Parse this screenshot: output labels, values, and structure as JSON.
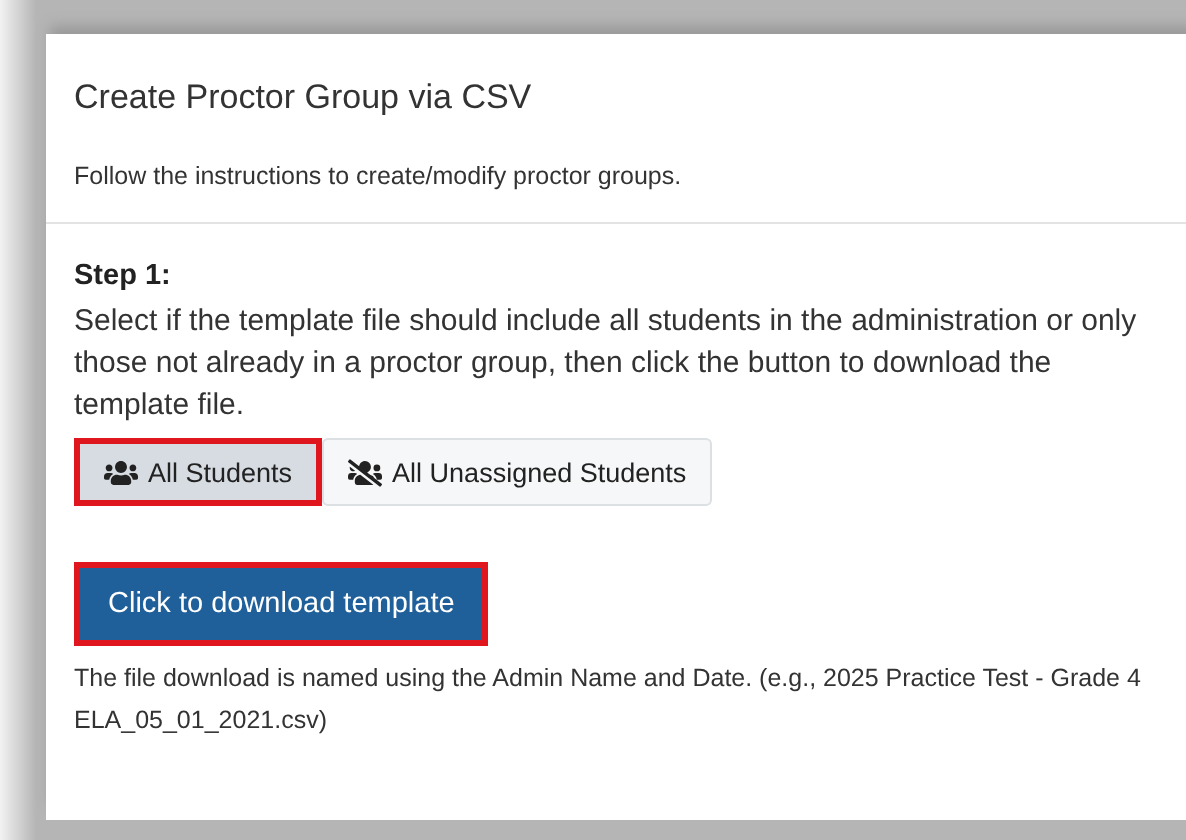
{
  "dialog": {
    "title": "Create Proctor Group via CSV",
    "subtitle": "Follow the instructions to create/modify proctor groups."
  },
  "step": {
    "heading": "Step 1:",
    "instructions": "Select if the template file should include all students in the administration or only those not already in a proctor group, then click the button to download the template file."
  },
  "options": [
    {
      "label": "All Students",
      "kind": "all",
      "selected": true,
      "highlighted": true
    },
    {
      "label": "All Unassigned Students",
      "kind": "unassigned",
      "selected": false,
      "highlighted": false
    }
  ],
  "download": {
    "label": "Click to download template",
    "highlighted": true
  },
  "note": "The file download is named using the Admin Name and Date. (e.g., 2025 Practice Test - Grade 4 ELA_05_01_2021.csv)"
}
